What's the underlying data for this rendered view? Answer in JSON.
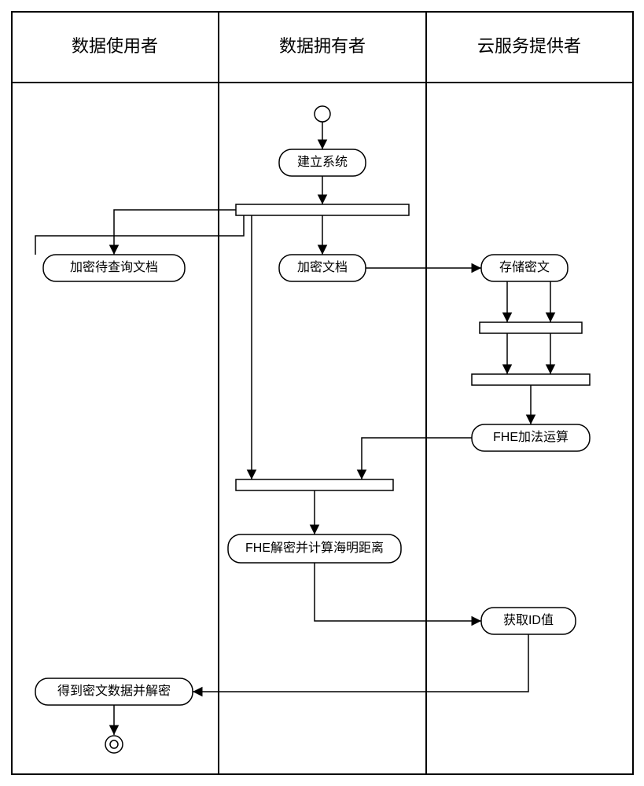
{
  "chart_data": {
    "type": "swimlane",
    "lanes": [
      {
        "id": "user",
        "label": "数据使用者"
      },
      {
        "id": "owner",
        "label": "数据拥有者"
      },
      {
        "id": "cloud",
        "label": "云服务提供者"
      }
    ],
    "nodes": {
      "start": {
        "lane": "owner",
        "type": "start"
      },
      "build": {
        "lane": "owner",
        "type": "action",
        "label": "建立系统"
      },
      "fork1": {
        "lane": "owner",
        "type": "fork"
      },
      "encQuery": {
        "lane": "user",
        "type": "action",
        "label": "加密待查询文档"
      },
      "encDoc": {
        "lane": "owner",
        "type": "action",
        "label": "加密文档"
      },
      "store": {
        "lane": "cloud",
        "type": "action",
        "label": "存储密文"
      },
      "fork2": {
        "lane": "cloud",
        "type": "fork"
      },
      "join2": {
        "lane": "cloud",
        "type": "join"
      },
      "fheAdd": {
        "lane": "cloud",
        "type": "action",
        "label": "FHE加法运算"
      },
      "join1": {
        "lane": "owner",
        "type": "join"
      },
      "fheDec": {
        "lane": "owner",
        "type": "action",
        "label": "FHE解密并计算海明距离"
      },
      "getId": {
        "lane": "cloud",
        "type": "action",
        "label": "获取ID值"
      },
      "result": {
        "lane": "user",
        "type": "action",
        "label": "得到密文数据并解密"
      },
      "end": {
        "lane": "user",
        "type": "end"
      }
    },
    "edges": [
      [
        "start",
        "build"
      ],
      [
        "build",
        "fork1"
      ],
      [
        "fork1",
        "encQuery"
      ],
      [
        "fork1",
        "encDoc"
      ],
      [
        "encDoc",
        "store"
      ],
      [
        "store",
        "fork2"
      ],
      [
        "encQuery",
        "fork2"
      ],
      [
        "fork2",
        "join2"
      ],
      [
        "fork2",
        "join2"
      ],
      [
        "join2",
        "fheAdd"
      ],
      [
        "fheAdd",
        "join1"
      ],
      [
        "fork1",
        "join1"
      ],
      [
        "join1",
        "fheDec"
      ],
      [
        "fheDec",
        "getId"
      ],
      [
        "getId",
        "result"
      ],
      [
        "result",
        "end"
      ]
    ]
  }
}
